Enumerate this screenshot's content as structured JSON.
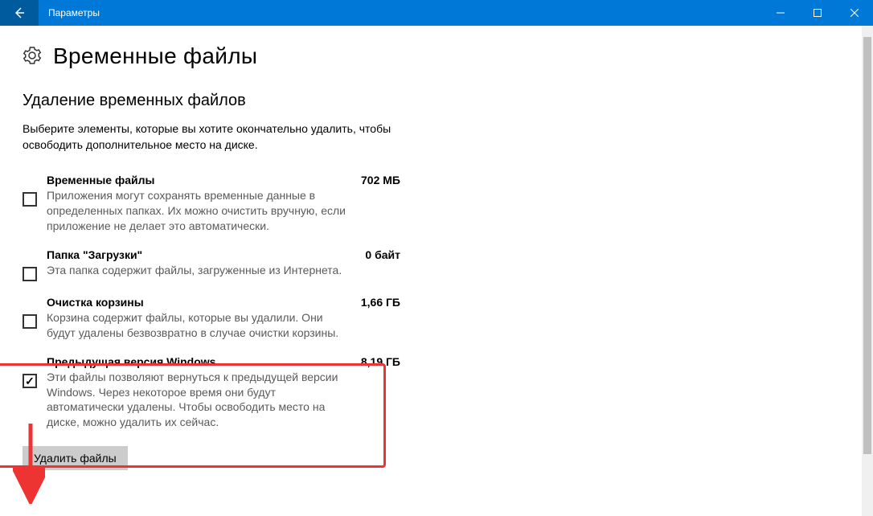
{
  "window": {
    "title": "Параметры"
  },
  "page": {
    "title": "Временные файлы",
    "section_heading": "Удаление временных файлов",
    "intro": "Выберите элементы, которые вы хотите окончательно удалить, чтобы освободить дополнительное место на диске."
  },
  "items": [
    {
      "title": "Временные файлы",
      "size": "702 МБ",
      "desc": "Приложения могут сохранять временные данные в определенных папках. Их можно очистить вручную, если приложение не делает это автоматически.",
      "checked": false
    },
    {
      "title": "Папка \"Загрузки\"",
      "size": "0 байт",
      "desc": "Эта папка содержит файлы, загруженные из Интернета.",
      "checked": false
    },
    {
      "title": "Очистка корзины",
      "size": "1,66 ГБ",
      "desc": "Корзина содержит файлы, которые вы удалили. Они будут удалены безвозвратно в случае очистки корзины.",
      "checked": false
    },
    {
      "title": "Предыдущая версия Windows",
      "size": "8,19 ГБ",
      "desc": "Эти файлы позволяют вернуться к предыдущей версии Windows. Через некоторое время они будут автоматически удалены. Чтобы освободить место на диске, можно удалить их сейчас.",
      "checked": true
    }
  ],
  "buttons": {
    "delete": "Удалить файлы"
  }
}
